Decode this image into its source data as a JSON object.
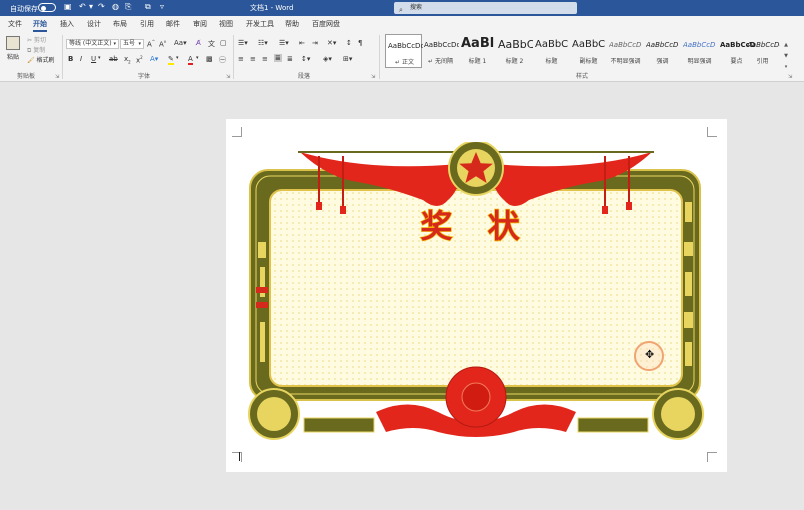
{
  "titlebar": {
    "autosave_label": "自动保存",
    "doc_title": "文档1 - Word",
    "search_placeholder": "搜索"
  },
  "tabs": [
    {
      "label": "文件"
    },
    {
      "label": "开始"
    },
    {
      "label": "插入"
    },
    {
      "label": "设计"
    },
    {
      "label": "布局"
    },
    {
      "label": "引用"
    },
    {
      "label": "邮件"
    },
    {
      "label": "审阅"
    },
    {
      "label": "视图"
    },
    {
      "label": "开发工具"
    },
    {
      "label": "帮助"
    },
    {
      "label": "百度网盘"
    }
  ],
  "ribbon": {
    "clipboard": {
      "paste": "粘贴",
      "cut": "剪切",
      "copy": "复制",
      "format_painter": "格式刷",
      "label": "剪贴板"
    },
    "font": {
      "font_name": "等线 (中文正文)",
      "font_size": "五号",
      "label": "字体"
    },
    "paragraph": {
      "label": "段落"
    },
    "styles": {
      "label": "样式",
      "items": [
        {
          "sample": "AaBbCcDd",
          "name": "↵ 正文",
          "size": 7
        },
        {
          "sample": "AaBbCcDd",
          "name": "↵ 无间隔",
          "size": 7
        },
        {
          "sample": "AaBl",
          "name": "标题 1",
          "size": 13
        },
        {
          "sample": "AaBbC",
          "name": "标题 2",
          "size": 11
        },
        {
          "sample": "AaBbC",
          "name": "标题",
          "size": 10
        },
        {
          "sample": "AaBbC",
          "name": "副标题",
          "size": 10
        },
        {
          "sample": "AaBbCcD",
          "name": "不明显强调",
          "size": 7
        },
        {
          "sample": "AaBbCcD",
          "name": "强调",
          "size": 7
        },
        {
          "sample": "AaBbCcD",
          "name": "明显强调",
          "size": 7
        },
        {
          "sample": "AaBbCcD",
          "name": "要点",
          "size": 7
        },
        {
          "sample": "AaBbCcDd",
          "name": "引用",
          "size": 7
        }
      ]
    }
  },
  "certificate": {
    "title": "奖 状"
  },
  "colors": {
    "word_blue": "#2b579a",
    "frame_olive": "#6a6a1e",
    "gold": "#f4b400",
    "red": "#d52a1b"
  }
}
